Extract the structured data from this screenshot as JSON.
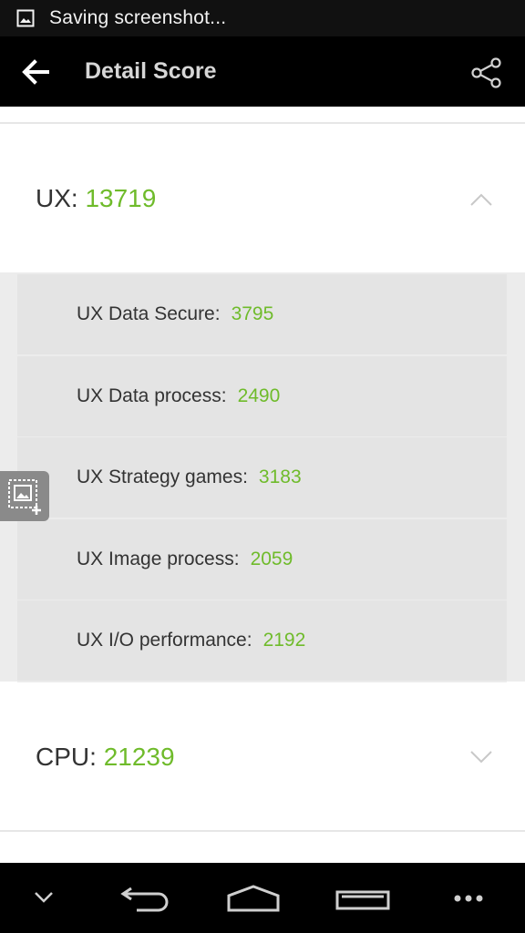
{
  "status_bar": {
    "icon": "image-icon",
    "text": "Saving screenshot..."
  },
  "action_bar": {
    "back_icon": "arrow-left-icon",
    "title": "Detail Score",
    "share_icon": "share-icon"
  },
  "sections": {
    "ux": {
      "label": "UX:",
      "score": "13719",
      "expanded": true
    },
    "cpu": {
      "label": "CPU:",
      "score": "21239",
      "expanded": false
    }
  },
  "ux_details": [
    {
      "label": "UX Data Secure:",
      "value": "3795"
    },
    {
      "label": "UX Data process:",
      "value": "2490"
    },
    {
      "label": "UX Strategy games:",
      "value": "3183"
    },
    {
      "label": "UX Image process:",
      "value": "2059"
    },
    {
      "label": "UX I/O performance:",
      "value": "2192"
    }
  ],
  "colors": {
    "score_green": "#6fbb2b",
    "action_bar": "#000000",
    "status_bar": "#111111"
  },
  "nav_bar": {
    "icons": [
      "chevron-down-icon",
      "back-icon",
      "home-icon",
      "recents-icon",
      "more-icon"
    ]
  }
}
